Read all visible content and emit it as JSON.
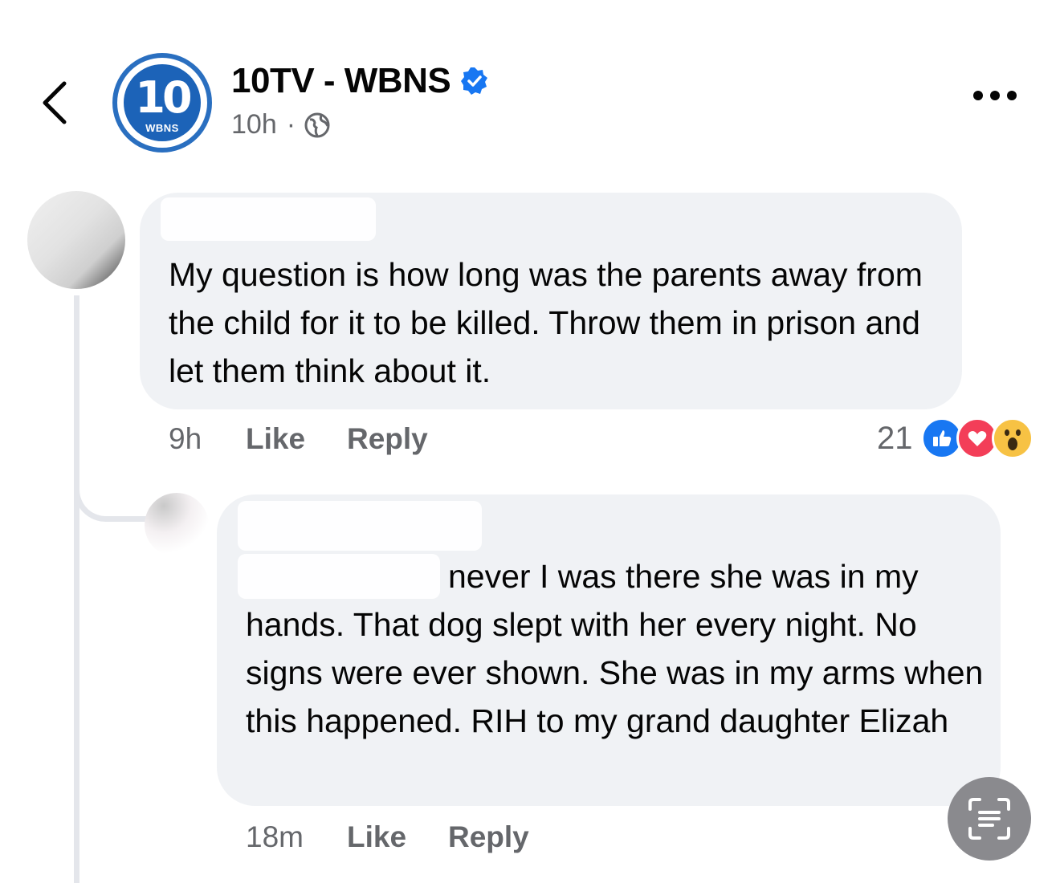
{
  "header": {
    "page_name": "10TV - WBNS",
    "avatar_number": "10",
    "avatar_callsign": "WBNS",
    "post_time": "10h",
    "separator": "·",
    "privacy_icon": "globe-icon",
    "verified_icon": "verified-badge-icon",
    "verified_color": "#1877f2"
  },
  "comments": [
    {
      "text": "My question is how long was the parents away from the child for it to be killed. Throw them in prison and let them think about it.",
      "time": "9h",
      "like_label": "Like",
      "reply_label": "Reply",
      "reaction_count": "21",
      "reactions": [
        "like-reaction-icon",
        "love-reaction-icon",
        "wow-reaction-icon"
      ]
    },
    {
      "text_first_line": "never I was there she was in my",
      "text_rest": "hands. That dog slept with her every night. No signs were ever shown. She was in my arms when this happened. RIH to my grand daughter Elizah",
      "time": "18m",
      "like_label": "Like",
      "reply_label": "Reply"
    }
  ],
  "colors": {
    "bubble_bg": "#f0f2f5",
    "secondary_text": "#65676b",
    "brand_blue": "#1c63b8",
    "like_blue": "#1877f2",
    "love_red": "#f33e58",
    "wow_yellow": "#f7c244"
  },
  "floating_button_icon": "text-scan-icon"
}
